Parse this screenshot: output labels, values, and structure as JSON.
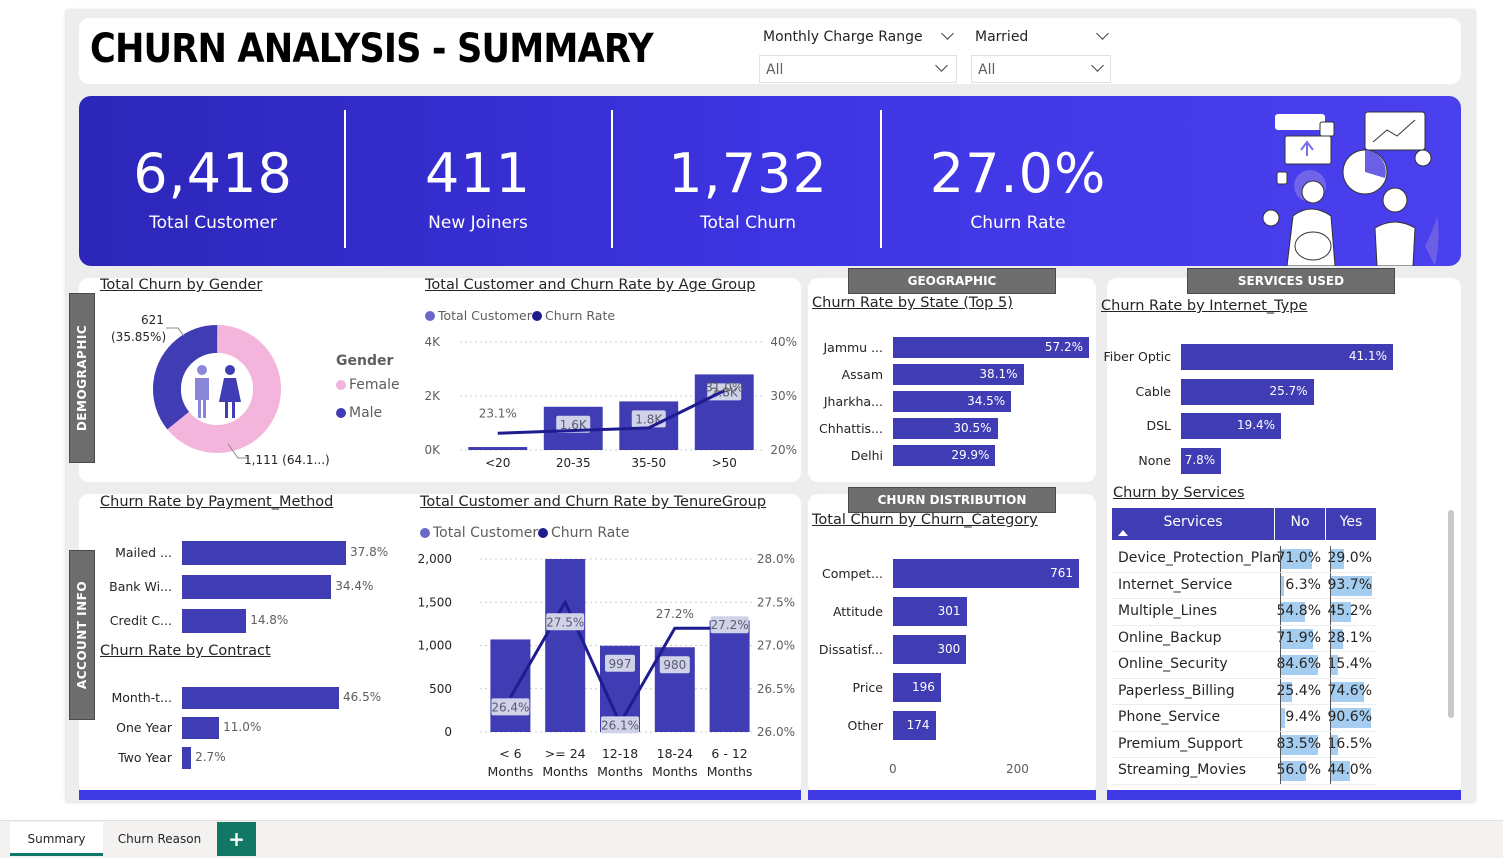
{
  "header": {
    "title": "CHURN ANALYSIS - SUMMARY",
    "slicers": [
      {
        "label": "Monthly Charge Range",
        "value": "All"
      },
      {
        "label": "Married",
        "value": "All"
      }
    ]
  },
  "kpis": [
    {
      "value": "6,418",
      "label": "Total Customer"
    },
    {
      "value": "411",
      "label": "New Joiners"
    },
    {
      "value": "1,732",
      "label": "Total Churn"
    },
    {
      "value": "27.0%",
      "label": "Churn Rate"
    }
  ],
  "section_tabs": {
    "demographic": "DEMOGRAPHIC",
    "account_info": "ACCOUNT INFO",
    "geographic": "GEOGRAPHIC",
    "services_used": "SERVICES USED",
    "churn_distribution": "CHURN DISTRIBUTION"
  },
  "colors": {
    "primary": "#3f3cb4",
    "accent_line": "#1f1c8f",
    "female": "#f3b5db",
    "kpi_band": "#3d34e2",
    "highlight": "#a5cdf0"
  },
  "chart_data": [
    {
      "id": "gender",
      "type": "pie",
      "title": "Total Churn by Gender",
      "legend_title": "Gender",
      "categories": [
        "Female",
        "Male"
      ],
      "values": [
        1111,
        621
      ],
      "labels": [
        "1,111 (64.1...)",
        "621 (35.85%)"
      ],
      "label_female": "1,111 (64.1...)",
      "label_male_value": "621",
      "label_male_pct": "(35.85%)"
    },
    {
      "id": "age",
      "type": "bar",
      "title": "Total Customer and Churn Rate by Age Group",
      "series": [
        {
          "name": "Total Customer",
          "values": [
            110,
            1600,
            1800,
            2800
          ],
          "labels": [
            "",
            "1.6K",
            "1.8K",
            "2.8K"
          ]
        },
        {
          "name": "Churn Rate",
          "values": [
            23.1,
            23.6,
            24.1,
            31.0
          ],
          "labels": [
            "23.1%",
            "",
            "",
            "31.0%"
          ]
        }
      ],
      "categories": [
        "<20",
        "20-35",
        "35-50",
        ">50"
      ],
      "y_ticks": [
        "0K",
        "2K",
        "4K"
      ],
      "y2_ticks": [
        "20%",
        "30%",
        "40%"
      ],
      "ylim": [
        0,
        4000
      ],
      "y2lim": [
        20,
        40
      ]
    },
    {
      "id": "payment",
      "type": "bar",
      "title": "Churn Rate by Payment_Method",
      "categories": [
        "Mailed ...",
        "Bank Wi...",
        "Credit C..."
      ],
      "values": [
        37.8,
        34.4,
        14.8
      ],
      "labels": [
        "37.8%",
        "34.4%",
        "14.8%"
      ]
    },
    {
      "id": "contract",
      "type": "bar",
      "title": "Churn Rate by Contract",
      "categories": [
        "Month-t...",
        "One Year",
        "Two Year"
      ],
      "values": [
        46.5,
        11.0,
        2.7
      ],
      "labels": [
        "46.5%",
        "11.0%",
        "2.7%"
      ]
    },
    {
      "id": "tenure",
      "type": "bar",
      "title": "Total Customer and Churn Rate by TenureGroup",
      "categories": [
        "< 6 Months",
        ">= 24 Months",
        "12-18 Months",
        "18-24 Months",
        "6 - 12 Months"
      ],
      "cat_line1": [
        "< 6",
        ">= 24",
        "12-18",
        "18-24",
        "6 - 12"
      ],
      "cat_line2": "Months",
      "series": [
        {
          "name": "Total Customer",
          "values": [
            1070,
            2000,
            997,
            980,
            1290
          ],
          "labels": [
            "",
            "",
            "997",
            "980",
            ""
          ]
        },
        {
          "name": "Churn Rate",
          "values": [
            26.4,
            27.5,
            26.1,
            27.2,
            27.2
          ],
          "labels": [
            "26.4%",
            "27.5%",
            "26.1%",
            "27.2%",
            "27.2%"
          ]
        }
      ],
      "y_ticks": [
        "0",
        "500",
        "1,000",
        "1,500",
        "2,000"
      ],
      "y2_ticks": [
        "26.0%",
        "26.5%",
        "27.0%",
        "27.5%",
        "28.0%"
      ],
      "ylim": [
        0,
        2000
      ],
      "y2lim": [
        26.0,
        28.0
      ]
    },
    {
      "id": "state",
      "type": "bar",
      "title": "Churn Rate by State (Top 5)",
      "categories": [
        "Jammu ...",
        "Assam",
        "Jharkha...",
        "Chhattis...",
        "Delhi"
      ],
      "values": [
        57.2,
        38.1,
        34.5,
        30.5,
        29.9
      ],
      "labels": [
        "57.2%",
        "38.1%",
        "34.5%",
        "30.5%",
        "29.9%"
      ]
    },
    {
      "id": "category",
      "type": "bar",
      "title": "Total Churn by Churn_Category",
      "categories": [
        "Compet...",
        "Attitude",
        "Dissatisf...",
        "Price",
        "Other"
      ],
      "values": [
        761,
        301,
        300,
        196,
        174
      ],
      "labels": [
        "761",
        "301",
        "300",
        "196",
        "174"
      ],
      "x_ticks": [
        "0",
        "200"
      ]
    },
    {
      "id": "internet",
      "type": "bar",
      "title": "Churn Rate by Internet_Type",
      "categories": [
        "Fiber Optic",
        "Cable",
        "DSL",
        "None"
      ],
      "values": [
        41.1,
        25.7,
        19.4,
        7.8
      ],
      "labels": [
        "41.1%",
        "25.7%",
        "19.4%",
        "7.8%"
      ]
    }
  ],
  "services_table": {
    "title": "Churn by Services",
    "headers": [
      "Services",
      "No",
      "Yes"
    ],
    "rows": [
      {
        "name": "Device_Protection_Plan",
        "no": "71.0%",
        "yes": "29.0%",
        "no_v": 71.0,
        "yes_v": 29.0
      },
      {
        "name": "Internet_Service",
        "no": "6.3%",
        "yes": "93.7%",
        "no_v": 6.3,
        "yes_v": 93.7
      },
      {
        "name": "Multiple_Lines",
        "no": "54.8%",
        "yes": "45.2%",
        "no_v": 54.8,
        "yes_v": 45.2
      },
      {
        "name": "Online_Backup",
        "no": "71.9%",
        "yes": "28.1%",
        "no_v": 71.9,
        "yes_v": 28.1
      },
      {
        "name": "Online_Security",
        "no": "84.6%",
        "yes": "15.4%",
        "no_v": 84.6,
        "yes_v": 15.4
      },
      {
        "name": "Paperless_Billing",
        "no": "25.4%",
        "yes": "74.6%",
        "no_v": 25.4,
        "yes_v": 74.6
      },
      {
        "name": "Phone_Service",
        "no": "9.4%",
        "yes": "90.6%",
        "no_v": 9.4,
        "yes_v": 90.6
      },
      {
        "name": "Premium_Support",
        "no": "83.5%",
        "yes": "16.5%",
        "no_v": 83.5,
        "yes_v": 16.5
      },
      {
        "name": "Streaming_Movies",
        "no": "56.0%",
        "yes": "44.0%",
        "no_v": 56.0,
        "yes_v": 44.0
      }
    ]
  },
  "page_tabs": [
    {
      "label": "Summary",
      "active": true
    },
    {
      "label": "Churn Reason",
      "active": false
    }
  ],
  "add_tab": "+"
}
